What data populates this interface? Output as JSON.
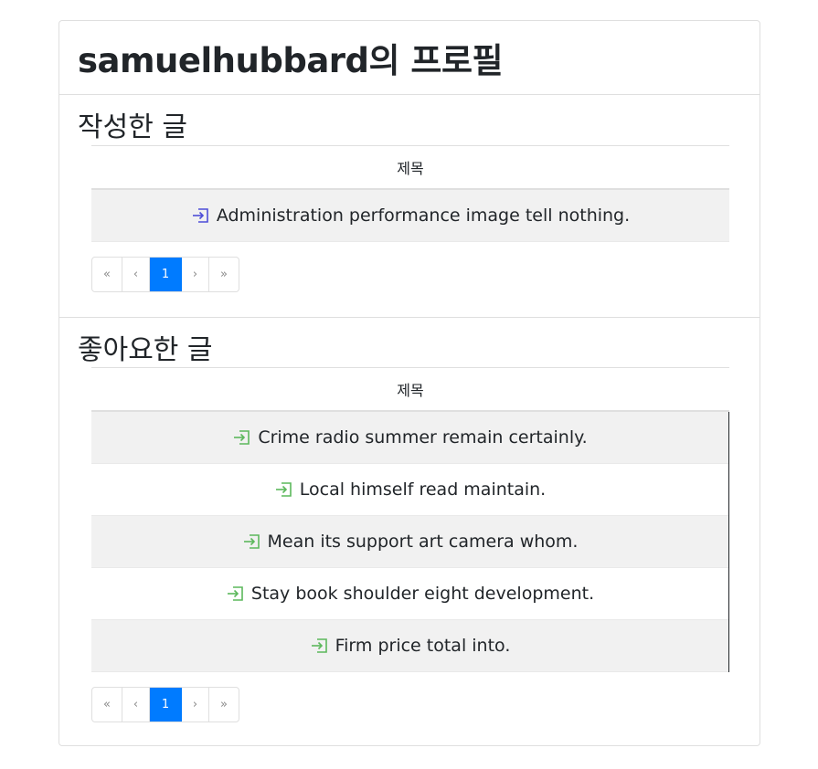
{
  "profile": {
    "title": "samuelhubbard의 프로필"
  },
  "written": {
    "heading": "작성한 글",
    "column_header": "제목",
    "icon_color": "#4d4dd8",
    "posts": [
      {
        "title": "Administration performance image tell nothing."
      }
    ],
    "pagination": {
      "first": "«",
      "prev": "‹",
      "current": "1",
      "next": "›",
      "last": "»"
    }
  },
  "liked": {
    "heading": "좋아요한 글",
    "column_header": "제목",
    "icon_color": "#5cb85c",
    "posts": [
      {
        "title": "Crime radio summer remain certainly."
      },
      {
        "title": "Local himself read maintain."
      },
      {
        "title": "Mean its support art camera whom."
      },
      {
        "title": "Stay book shoulder eight development."
      },
      {
        "title": "Firm price total into."
      }
    ],
    "pagination": {
      "first": "«",
      "prev": "‹",
      "current": "1",
      "next": "›",
      "last": "»"
    }
  },
  "icons": {
    "post_link": "box-arrow-in-right-icon"
  },
  "colors": {
    "active_page": "#007bff",
    "striped_row": "#f1f1f1"
  }
}
